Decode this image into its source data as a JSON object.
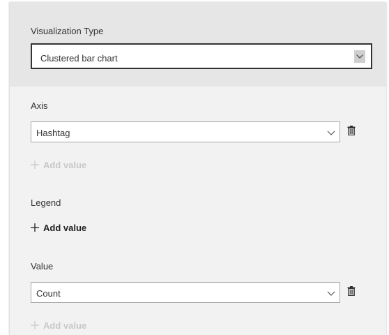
{
  "visualization": {
    "label": "Visualization Type",
    "selected": "Clustered bar chart"
  },
  "axis": {
    "label": "Axis",
    "field": "Hashtag",
    "add_label": "Add value"
  },
  "legend": {
    "label": "Legend",
    "add_label": "Add value"
  },
  "value": {
    "label": "Value",
    "field": "Count",
    "add_label": "Add value"
  },
  "icons": {
    "dropdown": "chevron-down-icon",
    "delete": "trash-icon",
    "add": "plus-icon"
  },
  "colors": {
    "panel_bg": "#f2f2f2",
    "header_bg": "#e6e6e6",
    "disabled_text": "#c8c8c8",
    "text": "#333333"
  }
}
